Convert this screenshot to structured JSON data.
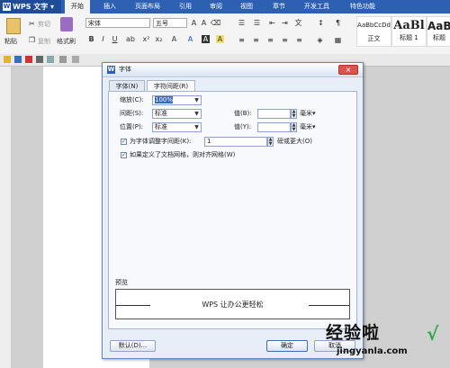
{
  "titlebar": {
    "app_logo": "W",
    "app_name": "WPS 文字",
    "dropdown_glyph": "▾",
    "menu_tabs": [
      "开始",
      "插入",
      "页面布局",
      "引用",
      "审阅",
      "视图",
      "章节",
      "开发工具",
      "特色功能"
    ],
    "active_tab": "开始",
    "accent_color": "#2d5fb3"
  },
  "ribbon": {
    "paste_label": "粘贴",
    "cut_label": "剪切",
    "copy_label": "复制",
    "format_painter_label": "格式刷",
    "font_name": "宋体",
    "font_size": "五号",
    "styles": [
      {
        "sample": "AaBbCcDd",
        "name": "正文"
      },
      {
        "sample": "AaBl",
        "name": "标题 1"
      },
      {
        "sample": "AaBb",
        "name": "标题"
      }
    ]
  },
  "dialog": {
    "icon": "W",
    "title": "字体",
    "close_glyph": "×",
    "tabs": [
      {
        "label": "字体(N)",
        "active": false
      },
      {
        "label": "字符间距(R)",
        "active": true
      }
    ],
    "scale_label": "缩放(C):",
    "scale_value": "100%",
    "spacing_label": "间距(S):",
    "spacing_value": "标准",
    "spacing_amount_label": "值(B):",
    "spacing_unit": "毫米",
    "position_label": "位置(P):",
    "position_value": "标准",
    "position_amount_label": "值(Y):",
    "position_unit": "毫米",
    "kerning_label": "为字体调整字间距(K):",
    "kerning_checked": true,
    "kerning_value": "1",
    "kerning_suffix": "磅或更大(O)",
    "grid_label": "如果定义了文档网格，则对齐网格(W)",
    "grid_checked": true,
    "preview_label": "预览",
    "preview_text": "WPS 让办公更轻松",
    "default_button": "默认(D)...",
    "ok_button": "确定",
    "cancel_button": "取消"
  },
  "watermark": {
    "text": "经验啦",
    "check": "√",
    "url": "jingyanla.com"
  }
}
